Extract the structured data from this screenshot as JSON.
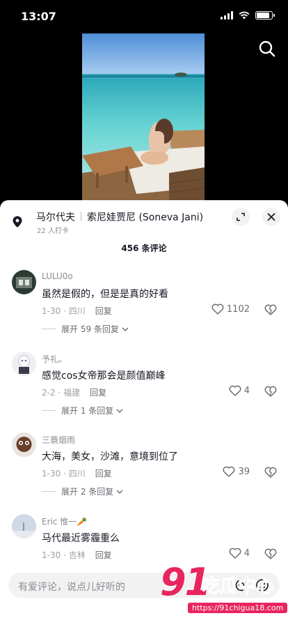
{
  "status": {
    "time": "13:07",
    "battery_level": 0.85
  },
  "location": {
    "name": "马尔代夫",
    "resort": "索尼娃贾尼 (Soneva Jani)",
    "checkins": "22 人打卡"
  },
  "comment_count": "456 条评论",
  "comments": [
    {
      "user": "LULU0o",
      "text": "虽然是假的，但是是真的好看",
      "date": "1-30",
      "region": "四川",
      "reply": "回复",
      "likes": "1102",
      "expand": "展开 59 条回复"
    },
    {
      "user": "予礼。",
      "text": "感觉cos女帝那会是颜值巅峰",
      "date": "2-2",
      "region": "福建",
      "reply": "回复",
      "likes": "4",
      "expand": "展开 1 条回复"
    },
    {
      "user": "三蓑烟雨",
      "text": "大海，美女，沙滩，意境到位了",
      "date": "1-30",
      "region": "四川",
      "reply": "回复",
      "likes": "39",
      "expand": "展开 2 条回复"
    },
    {
      "user": "Eric 惟一🥕",
      "text": "马代最近雾霾重么",
      "date": "1-30",
      "region": "吉林",
      "reply": "回复",
      "likes": "4",
      "expand": ""
    }
  ],
  "input": {
    "placeholder": "有爱评论，说点儿好听的"
  },
  "watermark": {
    "logo": "91",
    "name": "吃瓜中心",
    "url": "https://91chigua18.com"
  }
}
